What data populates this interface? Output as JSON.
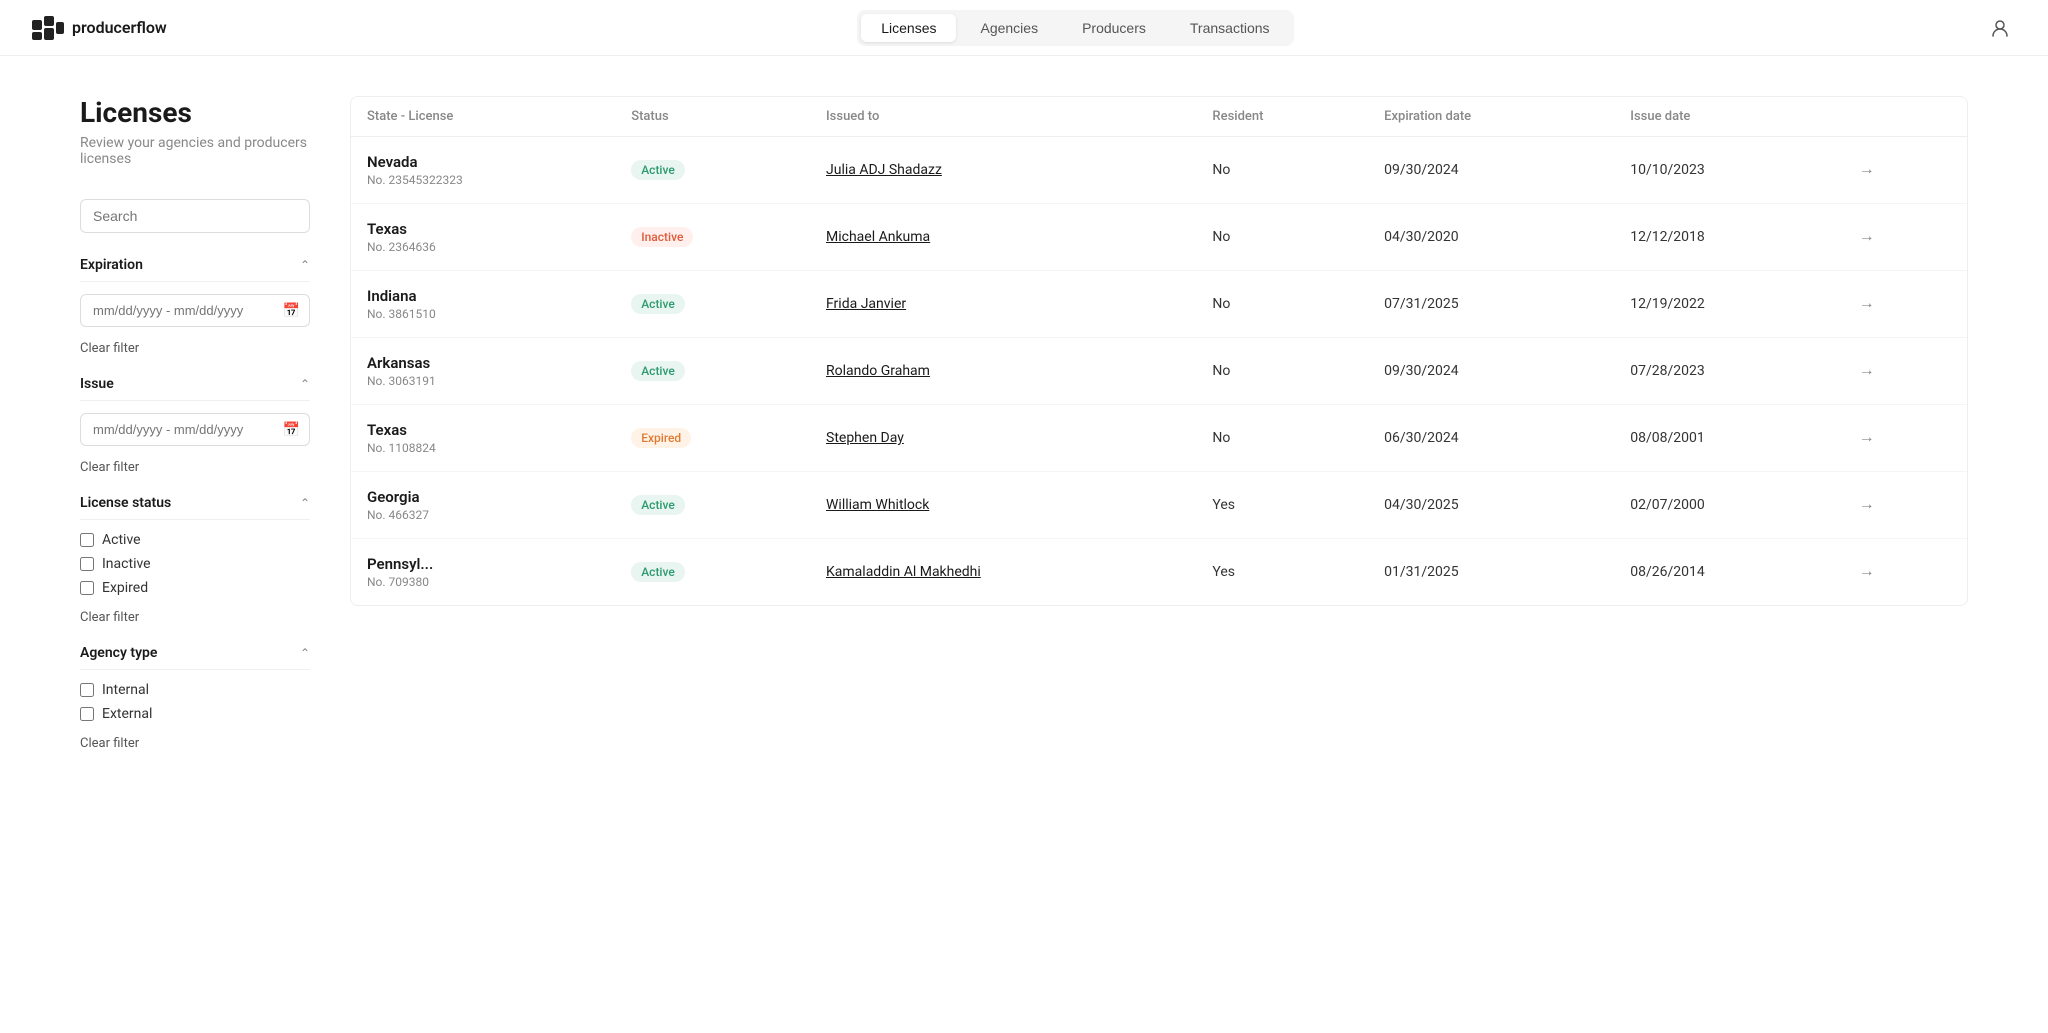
{
  "app": {
    "logo_text": "producerflow"
  },
  "nav": {
    "tabs": [
      {
        "id": "licenses",
        "label": "Licenses",
        "active": true
      },
      {
        "id": "agencies",
        "label": "Agencies",
        "active": false
      },
      {
        "id": "producers",
        "label": "Producers",
        "active": false
      },
      {
        "id": "transactions",
        "label": "Transactions",
        "active": false
      }
    ]
  },
  "page": {
    "title": "Licenses",
    "subtitle": "Review your agencies and producers licenses"
  },
  "sidebar": {
    "search_placeholder": "Search",
    "expiration_filter": {
      "title": "Expiration",
      "date_placeholder": "mm/dd/yyyy - mm/dd/yyyy",
      "clear_label": "Clear filter"
    },
    "issue_filter": {
      "title": "Issue",
      "date_placeholder": "mm/dd/yyyy - mm/dd/yyyy",
      "clear_label": "Clear filter"
    },
    "license_status_filter": {
      "title": "License status",
      "options": [
        "Active",
        "Inactive",
        "Expired"
      ],
      "clear_label": "Clear filter"
    },
    "agency_type_filter": {
      "title": "Agency type",
      "options": [
        "Internal",
        "External"
      ],
      "clear_label": "Clear filter"
    }
  },
  "table": {
    "columns": [
      {
        "id": "state_license",
        "label": "State - License"
      },
      {
        "id": "status",
        "label": "Status"
      },
      {
        "id": "issued_to",
        "label": "Issued to"
      },
      {
        "id": "resident",
        "label": "Resident"
      },
      {
        "id": "expiration_date",
        "label": "Expiration date"
      },
      {
        "id": "issue_date",
        "label": "Issue date"
      },
      {
        "id": "action",
        "label": ""
      }
    ],
    "rows": [
      {
        "state": "Nevada",
        "license_no": "No. 23545322323",
        "status": "Active",
        "status_type": "active",
        "issued_to": "Julia ADJ Shadazz",
        "resident": "No",
        "expiration_date": "09/30/2024",
        "issue_date": "10/10/2023"
      },
      {
        "state": "Texas",
        "license_no": "No. 2364636",
        "status": "Inactive",
        "status_type": "inactive",
        "issued_to": "Michael Ankuma",
        "resident": "No",
        "expiration_date": "04/30/2020",
        "issue_date": "12/12/2018"
      },
      {
        "state": "Indiana",
        "license_no": "No. 3861510",
        "status": "Active",
        "status_type": "active",
        "issued_to": "Frida Janvier",
        "resident": "No",
        "expiration_date": "07/31/2025",
        "issue_date": "12/19/2022"
      },
      {
        "state": "Arkansas",
        "license_no": "No. 3063191",
        "status": "Active",
        "status_type": "active",
        "issued_to": "Rolando Graham",
        "resident": "No",
        "expiration_date": "09/30/2024",
        "issue_date": "07/28/2023"
      },
      {
        "state": "Texas",
        "license_no": "No. 1108824",
        "status": "Expired",
        "status_type": "expired",
        "issued_to": "Stephen Day",
        "resident": "No",
        "expiration_date": "06/30/2024",
        "issue_date": "08/08/2001"
      },
      {
        "state": "Georgia",
        "license_no": "No. 466327",
        "status": "Active",
        "status_type": "active",
        "issued_to": "William Whitlock",
        "resident": "Yes",
        "expiration_date": "04/30/2025",
        "issue_date": "02/07/2000"
      },
      {
        "state": "Pennsyl...",
        "license_no": "No. 709380",
        "status": "Active",
        "status_type": "active",
        "issued_to": "Kamaladdin Al Makhedhi",
        "resident": "Yes",
        "expiration_date": "01/31/2025",
        "issue_date": "08/26/2014"
      }
    ]
  }
}
